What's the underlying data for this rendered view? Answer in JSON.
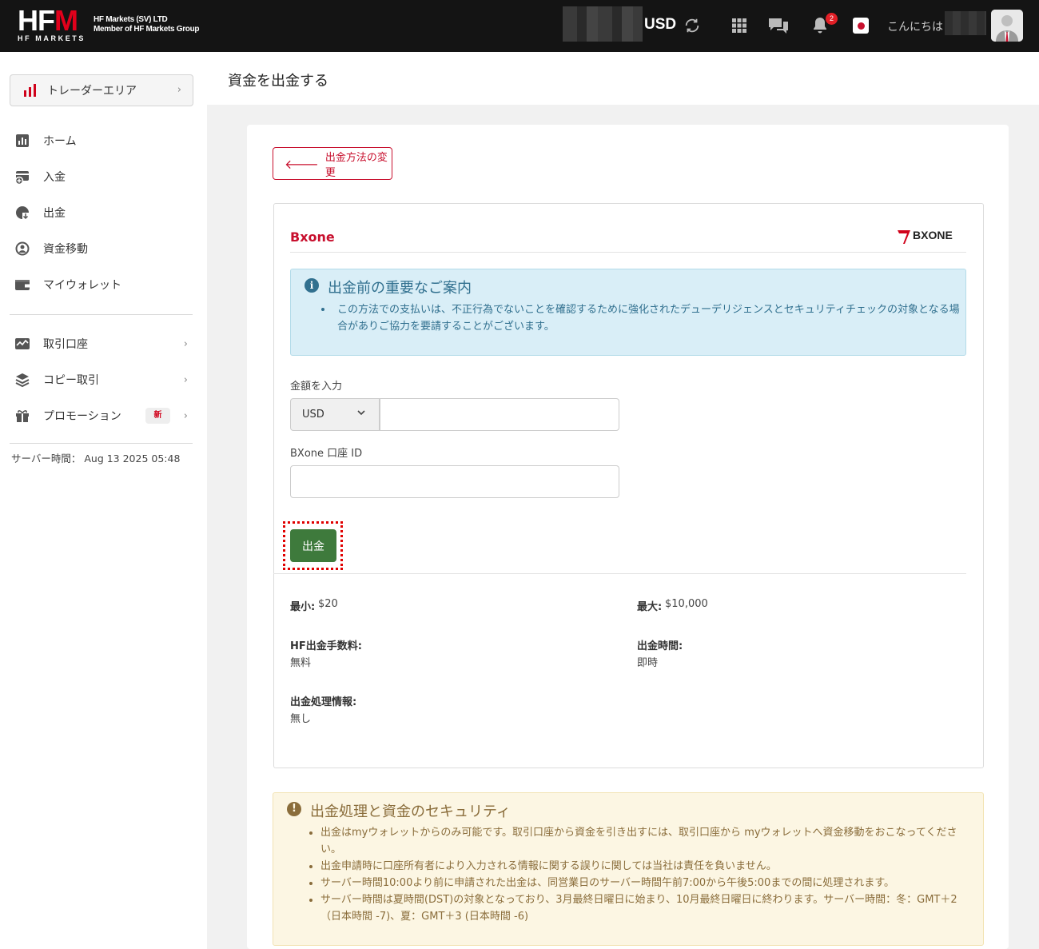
{
  "header": {
    "logo_text": "HFM",
    "logo_sub": "HF MARKETS",
    "company_line1": "HF Markets (SV) LTD",
    "company_line2": "Member of HF Markets Group",
    "currency": "USD",
    "notification_count": "2",
    "greeting": "こんにちは"
  },
  "sidebar": {
    "trader_area": "トレーダーエリア",
    "items": [
      {
        "label": "ホーム",
        "icon": "chart-icon"
      },
      {
        "label": "入金",
        "icon": "deposit-icon"
      },
      {
        "label": "出金",
        "icon": "withdraw-icon"
      },
      {
        "label": "資金移動",
        "icon": "transfer-icon"
      },
      {
        "label": "マイウォレット",
        "icon": "wallet-icon"
      }
    ],
    "items2": [
      {
        "label": "取引口座",
        "icon": "trading-account-icon"
      },
      {
        "label": "コピー取引",
        "icon": "layers-icon"
      },
      {
        "label": "プロモーション",
        "icon": "gift-icon",
        "badge": "新"
      }
    ],
    "server_time": "サーバー時間： Aug 13 2025 05:48"
  },
  "page": {
    "title": "資金を出金する",
    "back_button": "出金方法の変更",
    "method_name": "Bxone",
    "method_logo": "BXONE",
    "info": {
      "title": "出金前の重要なご案内",
      "text": "この方法での支払いは、不正行為でないことを確認するために強化されたデューデリジェンスとセキュリティチェックの対象となる場合がありご協力を要請することがございます。"
    },
    "form": {
      "amount_label": "金額を入力",
      "currency_selected": "USD",
      "amount_value": "",
      "account_label": "BXone 口座 ID",
      "account_value": "",
      "submit_label": "出金"
    },
    "limits": {
      "min_label": "最小:",
      "min_value": "$20",
      "max_label": "最大:",
      "max_value": "$10,000",
      "fee_label": "HF出金手数料:",
      "fee_value": "無料",
      "time_label": "出金時間:",
      "time_value": "即時",
      "processing_label": "出金処理情報:",
      "processing_value": "無し"
    },
    "security": {
      "title": "出金処理と資金のセキュリティ",
      "items": [
        "出金はmyウォレットからのみ可能です。取引口座から資金を引き出すには、取引口座から myウォレットへ資金移動をおこなってください。",
        "出金申請時に口座所有者により入力される情報に関する誤りに関しては当社は責任を負いません。",
        "サーバー時間10:00より前に申請された出金は、同営業日のサーバー時間午前7:00から午後5:00までの間に処理されます。",
        "サーバー時間は夏時間(DST)の対象となっており、3月最終日曜日に始まり、10月最終日曜日に終わります。サーバー時間：冬：GMT＋2（日本時間 -7)、夏：GMT＋3 (日本時間 -6)"
      ]
    }
  },
  "colors": {
    "brand_red": "#c8102e",
    "submit_green": "#3e7a3c",
    "info_blue": "#31708f",
    "warning_brown": "#8a6d3b"
  }
}
